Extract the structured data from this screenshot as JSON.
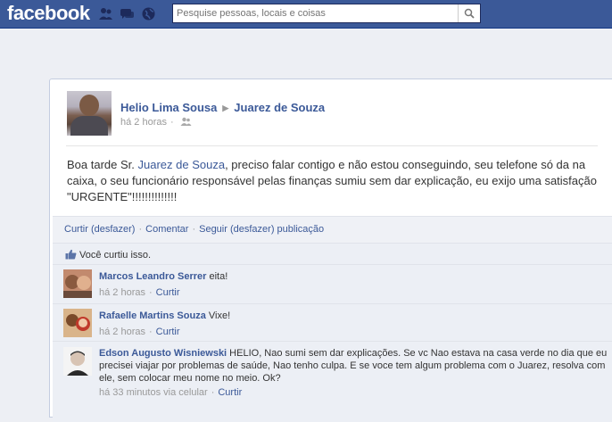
{
  "header": {
    "logo": "facebook",
    "search_placeholder": "Pesquise pessoas, locais e coisas"
  },
  "post": {
    "author": "Helio Lima Sousa",
    "target": "Juarez de Souza",
    "time": "há 2 horas",
    "message_pre": "Boa tarde Sr. ",
    "message_mention": "Juarez de Souza",
    "message_post": ", preciso falar contigo e não estou conseguindo, seu telefone só da na caixa, o seu funcionário responsável pelas finanças sumiu sem dar explicação, eu exijo uma satisfação \"URGENTE\"!!!!!!!!!!!!!!",
    "actions": {
      "like": "Curtir (desfazer)",
      "comment": "Comentar",
      "follow": "Seguir (desfazer) publicação"
    },
    "likes_text": "Você curtiu isso."
  },
  "comments": [
    {
      "author": "Marcos Leandro Serrer",
      "text": " eita!",
      "time": "há 2 horas",
      "action": "Curtir"
    },
    {
      "author": "Rafaelle Martins Souza",
      "text": " Vixe!",
      "time": "há 2 horas",
      "action": "Curtir"
    },
    {
      "author": "Edson Augusto Wisniewski",
      "text": " HELIO, Nao sumi sem dar explicações. Se vc Nao estava na casa verde no dia que eu precisei viajar por problemas de saúde, Nao tenho culpa. E se voce tem algum problema com o Juarez, resolva com ele, sem colocar meu nome no meio. Ok?",
      "time": "há 33 minutos via celular",
      "action": "Curtir"
    }
  ],
  "colors": {
    "brand": "#3b5998",
    "background": "#edeff4",
    "comment_bg": "#eceff5"
  }
}
